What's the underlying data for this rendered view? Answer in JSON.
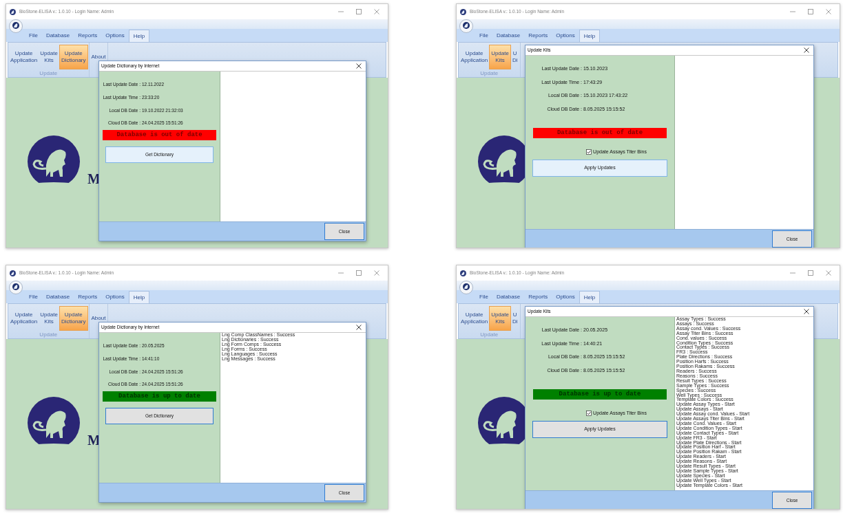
{
  "windows": [
    {
      "title": "BioStone-ELISA v.: 1.0.10 - Login Name: Admin",
      "tabs": [
        {
          "label": "File",
          "selected": false
        },
        {
          "label": "Database",
          "selected": false
        },
        {
          "label": "Reports",
          "selected": false
        },
        {
          "label": "Options",
          "selected": false
        },
        {
          "label": "Help",
          "selected": true
        }
      ],
      "ribbon_groups": [
        {
          "label": "Update",
          "buttons": [
            {
              "lines": [
                "Update",
                "Application"
              ],
              "selected": false
            },
            {
              "lines": [
                "Update",
                "Kits"
              ],
              "selected": false
            },
            {
              "lines": [
                "Update",
                "Dictionary"
              ],
              "selected": true
            }
          ]
        },
        {
          "buttons": [
            {
              "lines": [
                "About"
              ],
              "selected": false
            }
          ]
        }
      ],
      "logo_text": "M",
      "dialog": {
        "kind": "dictionary",
        "title": "Update Dictionary by Internet",
        "info": [
          {
            "label": "Last Update Date :",
            "value": "12.11.2022"
          },
          {
            "label": "Last Update Time :",
            "value": "23:33:20"
          },
          {
            "label": "Local DB Date :",
            "value": "19.10.2022 21:32:03"
          },
          {
            "label": "Cloud DB Date :",
            "value": "24.04.2025 15:51:26"
          }
        ],
        "status": {
          "text": "Database is out of date",
          "kind": "error"
        },
        "action": {
          "label": "Get Dictionary",
          "hovered": true
        },
        "close_button": "Close"
      }
    },
    {
      "title": "BioStone-ELISA v.: 1.0.10 - Login Name: Admin",
      "tabs": [
        {
          "label": "File",
          "selected": false
        },
        {
          "label": "Database",
          "selected": false
        },
        {
          "label": "Reports",
          "selected": false
        },
        {
          "label": "Options",
          "selected": false
        },
        {
          "label": "Help",
          "selected": true
        }
      ],
      "ribbon_groups": [
        {
          "label": "Update",
          "buttons": [
            {
              "lines": [
                "Update",
                "Application"
              ],
              "selected": false
            },
            {
              "lines": [
                "Update",
                "Kits"
              ],
              "selected": true
            },
            {
              "lines": [
                "U",
                "Di"
              ],
              "selected": false
            }
          ]
        }
      ],
      "dialog": {
        "kind": "kits",
        "title": "Update Kits",
        "info": [
          {
            "label": "Last Update Date :",
            "value": "15.10.2023"
          },
          {
            "label": "Last Update Time :",
            "value": "17:43:29"
          },
          {
            "label": "Local DB Date :",
            "value": "15.10.2023 17:43:22"
          },
          {
            "label": "Cloud DB Date :",
            "value": "8.05.2025 15:15:52"
          }
        ],
        "status": {
          "text": "Database is out of date",
          "kind": "error"
        },
        "checkbox": {
          "label": "Update Assays Titer Bins",
          "checked": true
        },
        "action": {
          "label": "Apply Updates",
          "hovered": true
        },
        "close_button": "Close"
      }
    },
    {
      "title": "BioStone-ELISA v.: 1.0.10 - Login Name: Admin",
      "tabs": [
        {
          "label": "File",
          "selected": false
        },
        {
          "label": "Database",
          "selected": false
        },
        {
          "label": "Reports",
          "selected": false
        },
        {
          "label": "Options",
          "selected": false
        },
        {
          "label": "Help",
          "selected": true
        }
      ],
      "ribbon_groups": [
        {
          "label": "Update",
          "buttons": [
            {
              "lines": [
                "Update",
                "Application"
              ],
              "selected": false
            },
            {
              "lines": [
                "Update",
                "Kits"
              ],
              "selected": false
            },
            {
              "lines": [
                "Update",
                "Dictionary"
              ],
              "selected": true
            }
          ]
        },
        {
          "buttons": [
            {
              "lines": [
                "About"
              ],
              "selected": false
            }
          ]
        }
      ],
      "logo_text": "M",
      "dialog": {
        "kind": "dictionary",
        "title": "Update Dictionary by Internet",
        "info": [
          {
            "label": "Last Update Date :",
            "value": "20.05.2025"
          },
          {
            "label": "Last Update Time :",
            "value": "14:41:10"
          },
          {
            "label": "Local DB Date :",
            "value": "24.04.2025 15:51:26"
          },
          {
            "label": "Cloud DB Date :",
            "value": "24.04.2025 15:51:26"
          }
        ],
        "status": {
          "text": "Database is up to date",
          "kind": "ok"
        },
        "action": {
          "label": "Get Dictionary",
          "hovered": false
        },
        "log": [
          "Lng Comp ClassNames : Success",
          "Lng Dictionaries : Success",
          "Lng Form Comps : Success",
          "Lng Forms : Success",
          "Lng Languages : Success",
          "Lng Messages : Success"
        ],
        "close_button": "Close"
      }
    },
    {
      "title": "BioStone-ELISA v.: 1.0.10 - Login Name: Admin",
      "tabs": [
        {
          "label": "File",
          "selected": false
        },
        {
          "label": "Database",
          "selected": false
        },
        {
          "label": "Reports",
          "selected": false
        },
        {
          "label": "Options",
          "selected": false
        },
        {
          "label": "Help",
          "selected": true
        }
      ],
      "ribbon_groups": [
        {
          "label": "Update",
          "buttons": [
            {
              "lines": [
                "Update",
                "Application"
              ],
              "selected": false
            },
            {
              "lines": [
                "Update",
                "Kits"
              ],
              "selected": true
            },
            {
              "lines": [
                "U",
                "Di"
              ],
              "selected": false
            }
          ]
        }
      ],
      "dialog": {
        "kind": "kits",
        "title": "Update Kits",
        "info": [
          {
            "label": "Last Update Date :",
            "value": "20.05.2025"
          },
          {
            "label": "Last Update Time :",
            "value": "14:40:21"
          },
          {
            "label": "Local DB Date :",
            "value": "8.05.2025 15:15:52"
          },
          {
            "label": "Cloud DB Date :",
            "value": "8.05.2025 15:15:52"
          }
        ],
        "status": {
          "text": "Database is up to date",
          "kind": "ok"
        },
        "checkbox": {
          "label": "Update Assays Titer Bins",
          "checked": true
        },
        "action": {
          "label": "Apply Updates",
          "hovered": false
        },
        "log": [
          "Assay Types : Success",
          "Assays : Success",
          "Assay cond. Values : Success",
          "Assay Titer Bins : Success",
          "Cond. values : Success",
          "Condition Types : Success",
          "Contact Types : Success",
          "FR3 : Success",
          "Plate Directions : Success",
          "Position Harfs : Success",
          "Position Rakams : Success",
          "Readers : Success",
          "Reasons : Success",
          "Result Types : Success",
          "Sample Types : Success",
          "Species : Success",
          "Well Types : Success",
          "Template Colors : Success",
          "Update Assay Types - Start",
          "Update Assays - Start",
          "Update Assay cond. Values - Start",
          "Update Assays Titer Bins - Start",
          "Update Cond. Values - Start",
          "Update Condition Types - Start",
          "Update Contact Types - Start",
          "Update FR3 - Start",
          "Update Plate Directions - Start",
          "Update Position Harf - Start",
          "Update Position Rakam - Start",
          "Update Readers - Start",
          "Update Reasons - Start",
          "Update Result Types - Start",
          "Update Sample Types - Start",
          "Update Species - Start",
          "Update Well Types - Start",
          "Update Template Colors - Start"
        ],
        "close_button": "Close"
      }
    }
  ]
}
